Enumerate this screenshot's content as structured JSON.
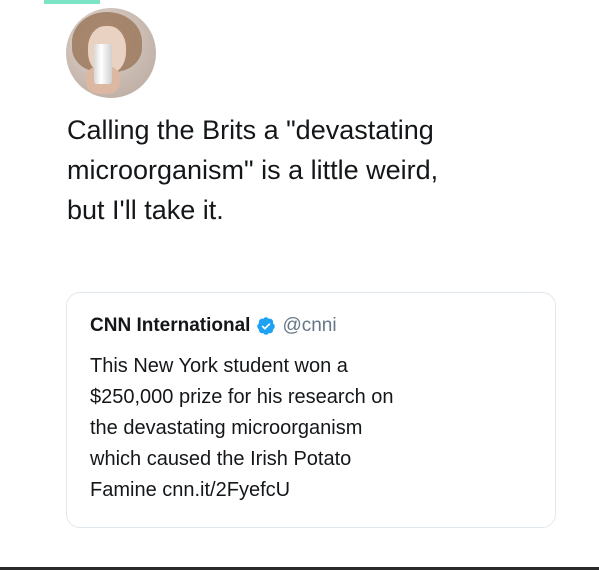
{
  "tweet": {
    "text": "Calling the Brits a \"devastating\nmicroorganism\" is a little weird,\nbut I'll take it."
  },
  "quoted_tweet": {
    "name": "CNN International",
    "handle": "@cnni",
    "verified_icon": "verified-badge-icon",
    "text": "This New York student won a\n$250,000 prize for his research on\nthe devastating microorganism\nwhich caused the Irish Potato\nFamine cnn.it/2FyefcU"
  },
  "colors": {
    "verified_blue": "#1da1f2",
    "text": "#14171a",
    "handle_gray": "#657786",
    "card_border": "#e1e8ed"
  }
}
